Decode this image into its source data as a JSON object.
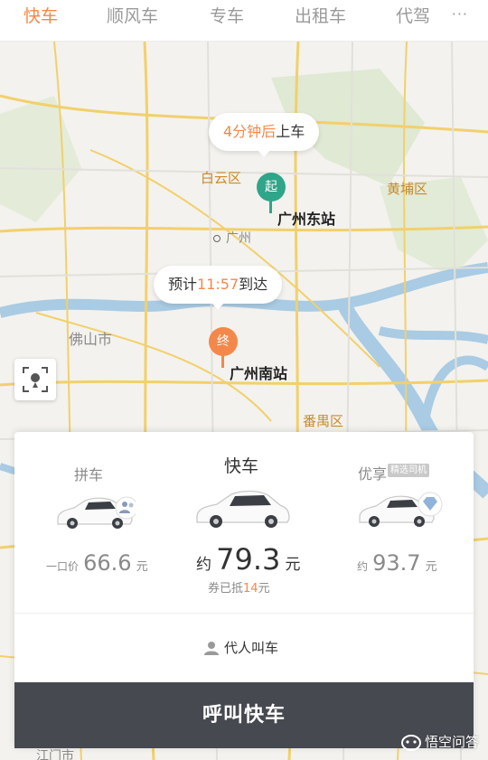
{
  "tabs": [
    {
      "label": "快车",
      "active": true
    },
    {
      "label": "顺风车",
      "active": false
    },
    {
      "label": "专车",
      "active": false
    },
    {
      "label": "出租车",
      "active": false
    },
    {
      "label": "代驾",
      "active": false
    }
  ],
  "tabs_more": "···",
  "map": {
    "districts": {
      "baiyun": "白云区",
      "huangpu": "黄埔区",
      "foshan": "佛山市",
      "panyu": "番禺区",
      "guangzhou": "广州",
      "jiangmen": "江门市"
    },
    "pickup_bubble": {
      "highlight": "4分钟后",
      "text": "上车"
    },
    "eta_bubble": {
      "prefix": "预计",
      "highlight": "11:57",
      "suffix": "到达"
    },
    "start_pin": "起",
    "end_pin": "终",
    "start_station": "广州东站",
    "end_station": "广州南站",
    "colors": {
      "start": "#2fa58a",
      "end": "#f4884a",
      "river": "#a9cbe3",
      "road": "#f2d06b"
    }
  },
  "options": {
    "pool": {
      "name": "拼车",
      "price_prefix": "一口价",
      "price": "66.6",
      "unit": "元"
    },
    "express": {
      "name": "快车",
      "price_prefix": "约",
      "price": "79.3",
      "unit": "元",
      "coupon_prefix": "券已抵",
      "coupon_amount": "14",
      "coupon_unit": "元"
    },
    "premium": {
      "name": "优享",
      "tag": "精选司机",
      "price_prefix": "约",
      "price": "93.7",
      "unit": "元"
    }
  },
  "proxy_label": "代人叫车",
  "call_button": "呼叫快车",
  "watermark": "悟空问答",
  "accent": "#f4884a"
}
